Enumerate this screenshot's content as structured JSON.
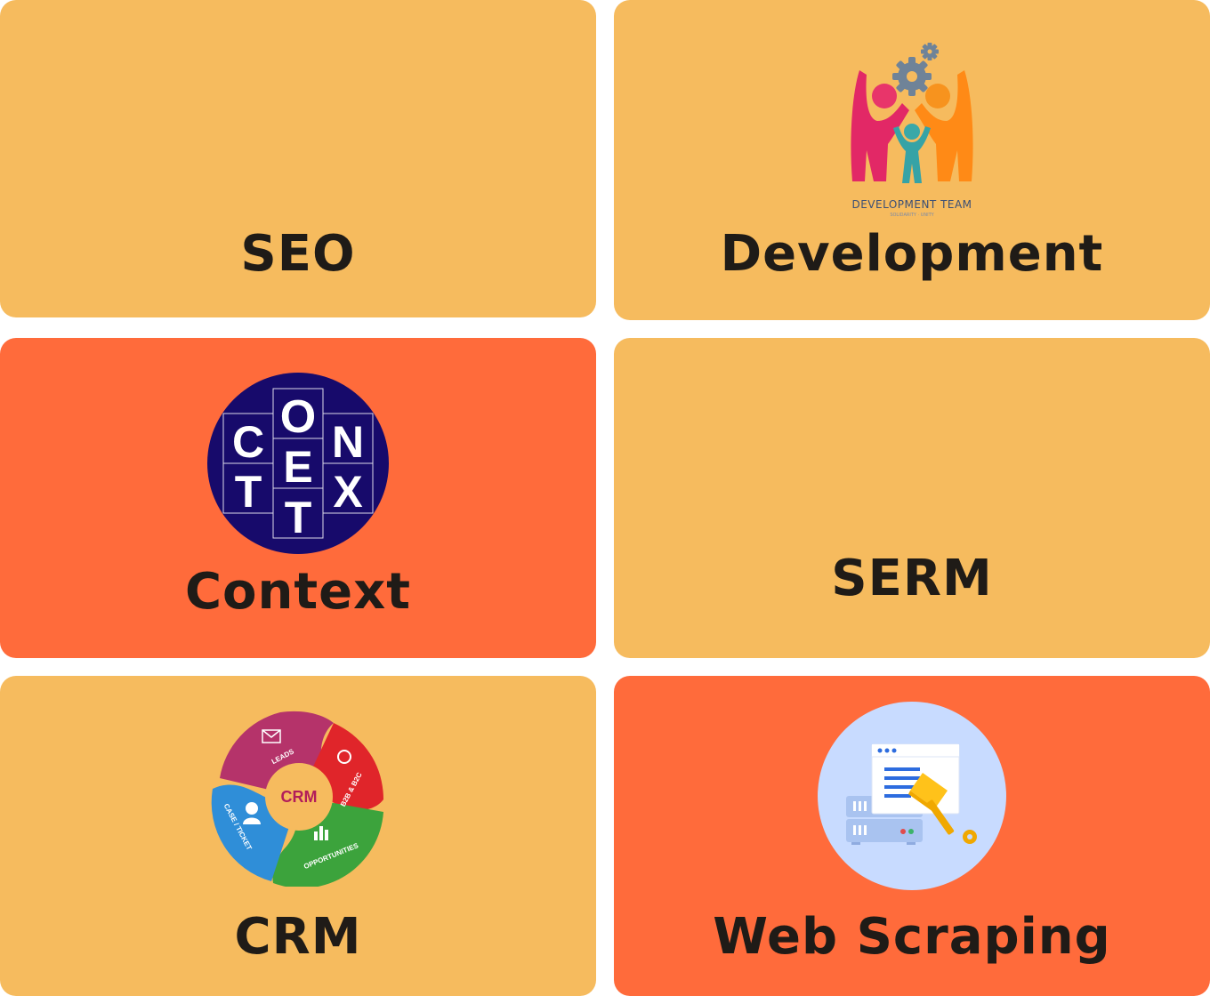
{
  "cards": [
    {
      "id": "seo",
      "title": "SEO"
    },
    {
      "id": "development",
      "title": "Development",
      "logo_caption": "DEVELOPMENT TEAM",
      "logo_subcaption": "SOLIDARITY · UNITY"
    },
    {
      "id": "context",
      "title": "Context",
      "logo_letters": [
        "C",
        "O",
        "N",
        "T",
        "E",
        "X",
        "T"
      ]
    },
    {
      "id": "serm",
      "title": "SERM"
    },
    {
      "id": "crm",
      "title": "CRM",
      "logo_center": "CRM",
      "logo_segments": [
        "LEADS",
        "B2B & B2C",
        "OPPORTUNITIES",
        "CASE / TICKET"
      ]
    },
    {
      "id": "web-scraping",
      "title": "Web Scraping"
    }
  ],
  "colors": {
    "amber": "#f6bb5e",
    "orange": "#ff6b3b",
    "text": "#1f1b17",
    "context_circle": "#170a6b",
    "scraping_circle": "#c8dbff"
  },
  "icons": [
    "development-team-icon",
    "context-logo-icon",
    "crm-cycle-icon",
    "web-scraping-icon"
  ]
}
